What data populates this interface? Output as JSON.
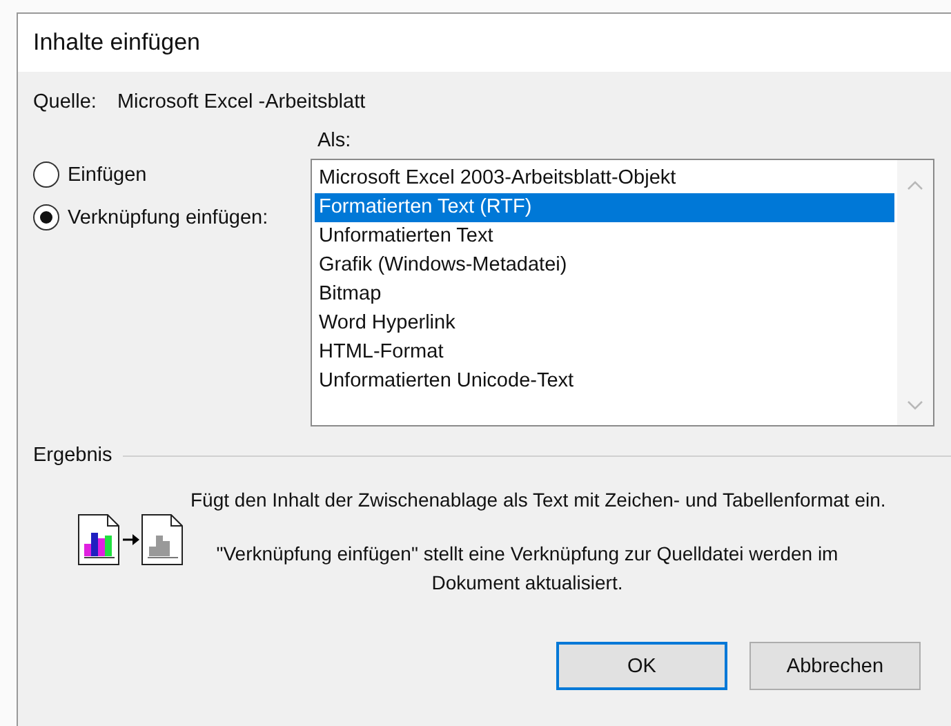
{
  "window": {
    "title": "Inhalte einfügen"
  },
  "source": {
    "label": "Quelle:",
    "value": "Microsoft Excel -Arbeitsblatt"
  },
  "options": [
    {
      "label": "Einfügen",
      "selected": false
    },
    {
      "label": "Verknüpfung einfügen:",
      "selected": true
    }
  ],
  "as_list": {
    "label": "Als:",
    "items": [
      {
        "label": "Microsoft Excel 2003-Arbeitsblatt-Objekt",
        "selected": false
      },
      {
        "label": "Formatierten Text (RTF)",
        "selected": true
      },
      {
        "label": "Unformatierten Text",
        "selected": false
      },
      {
        "label": "Grafik (Windows-Metadatei)",
        "selected": false
      },
      {
        "label": "Bitmap",
        "selected": false
      },
      {
        "label": "Word Hyperlink",
        "selected": false
      },
      {
        "label": "HTML-Format",
        "selected": false
      },
      {
        "label": "Unformatierten Unicode-Text",
        "selected": false
      }
    ]
  },
  "result": {
    "label": "Ergebnis",
    "description": "Fügt den Inhalt der Zwischenablage als Text mit Zeichen- und Tabellenformat ein.",
    "note": "\"Verknüpfung einfügen\" stellt eine Verknüpfung zur Quelldatei werden im Dokument aktualisiert."
  },
  "buttons": [
    {
      "label": "OK",
      "default": true
    },
    {
      "label": "Abbrechen",
      "default": false
    }
  ]
}
